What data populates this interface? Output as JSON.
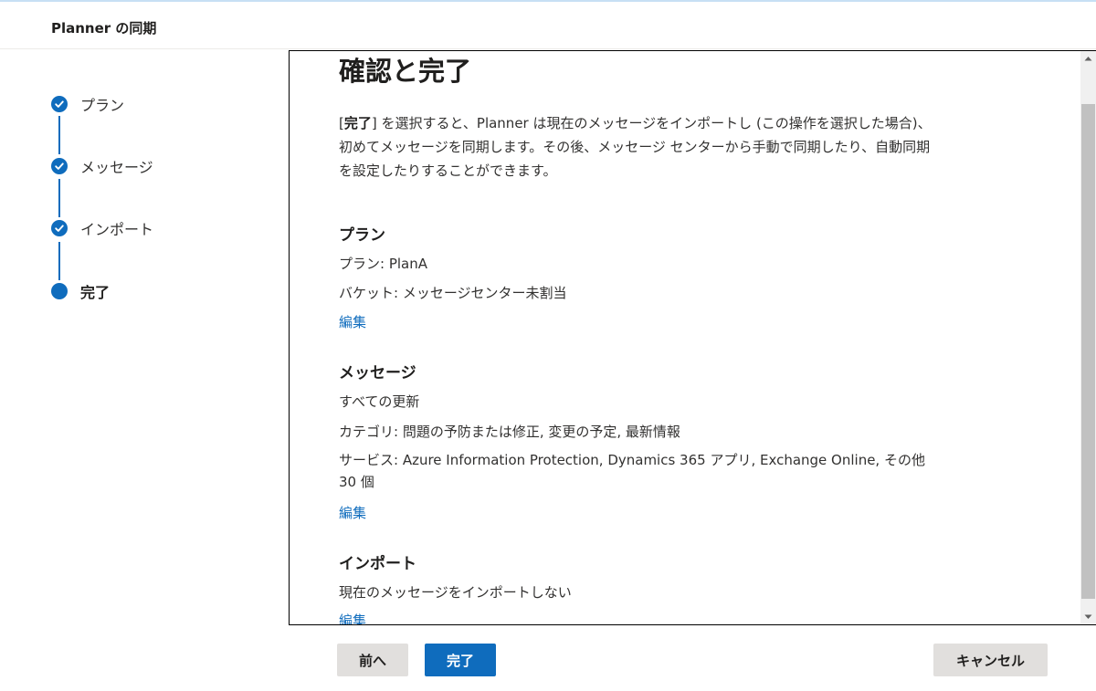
{
  "header": {
    "title": "Planner の同期"
  },
  "stepper": {
    "steps": [
      {
        "label": "プラン",
        "status": "complete"
      },
      {
        "label": "メッセージ",
        "status": "complete"
      },
      {
        "label": "インポート",
        "status": "complete"
      },
      {
        "label": "完了",
        "status": "current"
      }
    ]
  },
  "main": {
    "title": "確認と完了",
    "intro_bracket_open": "[",
    "intro_bold": "完了",
    "intro_rest": "] を選択すると、Planner は現在のメッセージをインポートし (この操作を選択した場合)、初めてメッセージを同期します。その後、メッセージ センターから手動で同期したり、自動同期を設定したりすることができます。",
    "sections": [
      {
        "heading": "プラン",
        "lines": [
          "プラン: PlanA",
          "バケット: メッセージセンター未割当"
        ],
        "edit_label": "編集"
      },
      {
        "heading": "メッセージ",
        "lines": [
          "すべての更新",
          "カテゴリ: 問題の予防または修正, 変更の予定, 最新情報",
          "サービス: Azure Information Protection, Dynamics 365 アプリ, Exchange Online, その他 30 個"
        ],
        "edit_label": "編集"
      },
      {
        "heading": "インポート",
        "lines": [
          "現在のメッセージをインポートしない"
        ],
        "edit_label": "編集"
      }
    ]
  },
  "footer": {
    "back_label": "前へ",
    "finish_label": "完了",
    "cancel_label": "キャンセル"
  },
  "colors": {
    "accent": "#0f6cbd",
    "secondary_button": "#e1dfdd"
  }
}
